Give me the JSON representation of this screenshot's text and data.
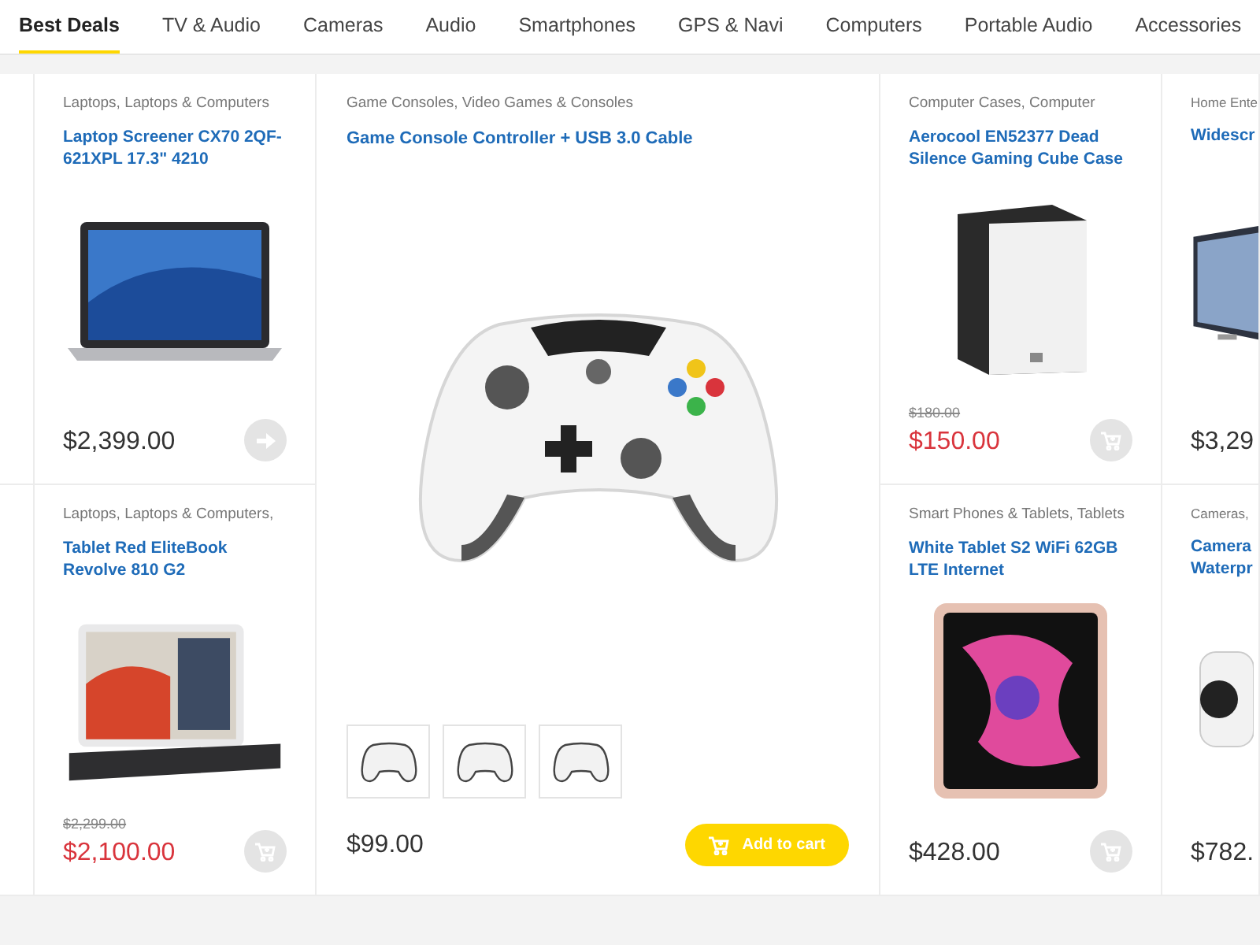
{
  "tabs": [
    {
      "label": "Best Deals",
      "selected": true
    },
    {
      "label": "TV & Audio",
      "selected": false
    },
    {
      "label": "Cameras",
      "selected": false
    },
    {
      "label": "Audio",
      "selected": false
    },
    {
      "label": "Smartphones",
      "selected": false
    },
    {
      "label": "GPS & Navi",
      "selected": false
    },
    {
      "label": "Computers",
      "selected": false
    },
    {
      "label": "Portable Audio",
      "selected": false
    },
    {
      "label": "Accessories",
      "selected": false
    }
  ],
  "products": [
    {
      "category": "Laptops, Laptops & Computers",
      "title": "Laptop Screener CX70 2QF-621XPL 17.3\" 4210",
      "price": "$2,399.00",
      "sale": false,
      "kind": "arrow"
    },
    {
      "category": "Computer Cases, Computer",
      "title": "Aerocool EN52377 Dead Silence Gaming Cube Case",
      "old_price": "$180.00",
      "price": "$150.00",
      "sale": true,
      "kind": "cart"
    },
    {
      "category": "Home Ente",
      "title": "Widescr",
      "price": "$3,29",
      "sale": false,
      "kind": "plain"
    },
    {
      "category": "Laptops, Laptops & Computers,",
      "title": "Tablet Red EliteBook Revolve 810 G2",
      "old_price": "$2,299.00",
      "price": "$2,100.00",
      "sale": true,
      "kind": "cart"
    },
    {
      "category": "Smart Phones & Tablets, Tablets",
      "title": "White Tablet S2 WiFi 62GB LTE Internet",
      "price": "$428.00",
      "sale": false,
      "kind": "cart"
    },
    {
      "category": "Cameras,",
      "title": "Camera Waterpr",
      "price": "$782.",
      "sale": false,
      "kind": "plain"
    }
  ],
  "featured": {
    "category": "Game Consoles, Video Games & Consoles",
    "title": "Game Console Controller + USB 3.0 Cable",
    "price": "$99.00",
    "button": "Add to cart"
  }
}
